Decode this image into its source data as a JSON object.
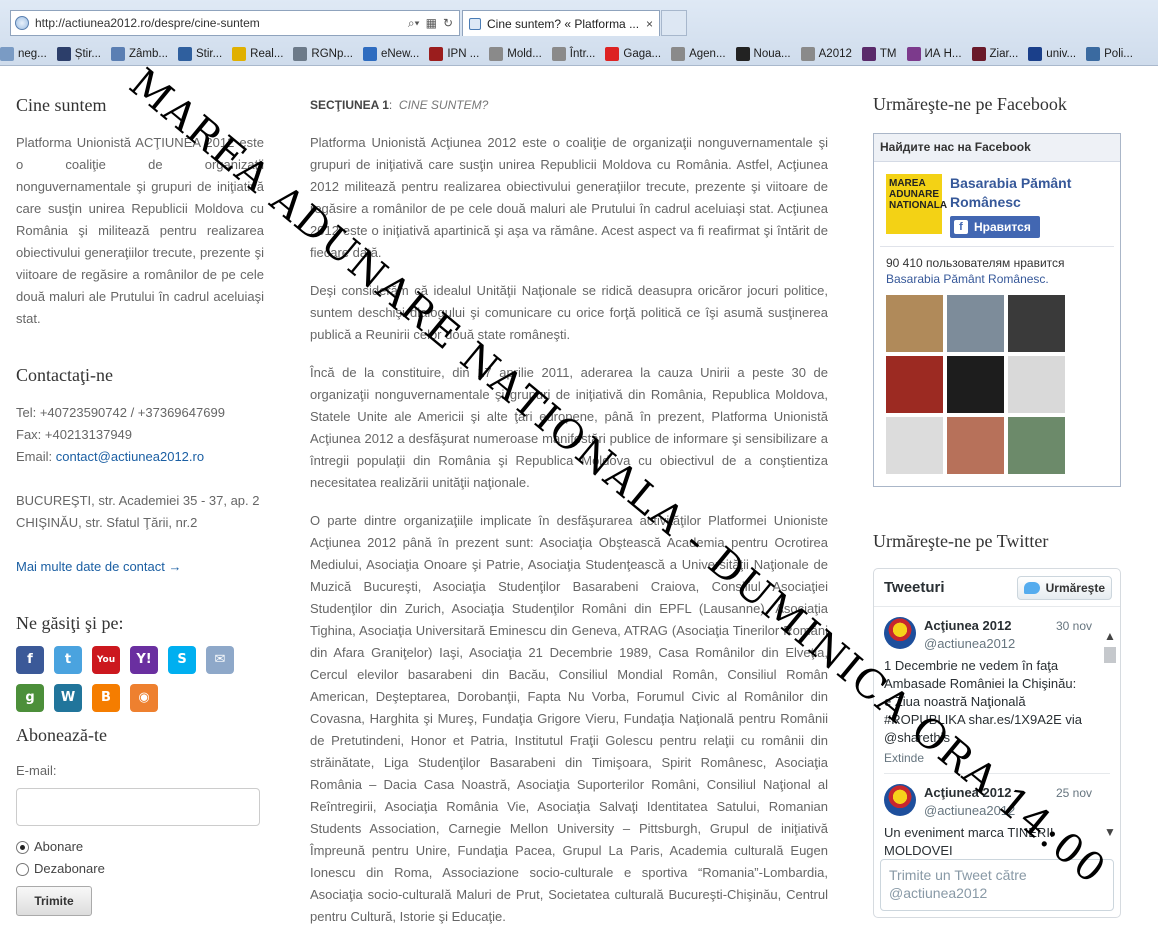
{
  "browser": {
    "url": "http://actiunea2012.ro/despre/cine-suntem",
    "tab_title": "Cine suntem? « Platforma ...",
    "tab_close": "×",
    "favorites": [
      {
        "label": "neg...",
        "color": "#7a9bc4"
      },
      {
        "label": "Știr...",
        "color": "#2c3e6a"
      },
      {
        "label": "Zâmb...",
        "color": "#5b7fb3"
      },
      {
        "label": "Stir...",
        "color": "#2f5f9e"
      },
      {
        "label": "Real...",
        "color": "#e0b000"
      },
      {
        "label": "RGNp...",
        "color": "#6c7a89"
      },
      {
        "label": "eNew...",
        "color": "#2e6cc0"
      },
      {
        "label": "IPN ...",
        "color": "#9b1d1d"
      },
      {
        "label": "Mold...",
        "color": "#8a8a8a"
      },
      {
        "label": "Într...",
        "color": "#8a8a8a"
      },
      {
        "label": "Gaga...",
        "color": "#d22"
      },
      {
        "label": "Agen...",
        "color": "#8a8a8a"
      },
      {
        "label": "Noua...",
        "color": "#222"
      },
      {
        "label": "A2012",
        "color": "#8a8a8a"
      },
      {
        "label": "TM",
        "color": "#5a2a6a"
      },
      {
        "label": "ИА Н...",
        "color": "#7c3a8c"
      },
      {
        "label": "Ziar...",
        "color": "#6a1a2a"
      },
      {
        "label": "univ...",
        "color": "#1a3f8a"
      },
      {
        "label": "Poli...",
        "color": "#3a6aa0"
      }
    ]
  },
  "left": {
    "about_title": "Cine suntem",
    "about_text": "Platforma Unionistă ACŢIUNEA 2012 este o coaliţie de organizaţii nonguvernamentale şi grupuri de iniţiativă care susţin unirea Republicii Moldova cu România şi militează pentru realizarea obiectivului generaţiilor trecute, prezente şi viitoare de regăsire a românilor de pe cele două maluri ale Prutului în cadrul aceluiaşi stat.",
    "contact_title": "Contactaţi-ne",
    "tel": "Tel: +40723590742 / +37369647699",
    "fax": "Fax: +40213137949",
    "email_label": "Email: ",
    "email": "contact@actiunea2012.ro",
    "addr1": "BUCUREŞTI, str. Academiei 35 - 37, ap. 2",
    "addr2": "CHIŞINĂU, str. Sfatul Ţării, nr.2",
    "more_contact": "Mai multe date de contact →",
    "social_title": "Ne găsiţi şi pe:",
    "social_icons": [
      {
        "name": "facebook-icon",
        "glyph": "f",
        "color": "#3b5998"
      },
      {
        "name": "twitter-icon",
        "glyph": "t",
        "color": "#4aa3df"
      },
      {
        "name": "youtube-icon",
        "glyph": "You",
        "color": "#cc181e"
      },
      {
        "name": "yahoo-icon",
        "glyph": "Y!",
        "color": "#6a2fa0"
      },
      {
        "name": "skype-icon",
        "glyph": "S",
        "color": "#00aff0"
      },
      {
        "name": "mail-icon",
        "glyph": "✉",
        "color": "#8ea8c9"
      },
      {
        "name": "google-icon",
        "glyph": "g",
        "color": "#4c8f3a"
      },
      {
        "name": "wordpress-icon",
        "glyph": "W",
        "color": "#21759b"
      },
      {
        "name": "blogger-icon",
        "glyph": "B",
        "color": "#f57d00"
      },
      {
        "name": "rss-icon",
        "glyph": "◉",
        "color": "#ee802f"
      }
    ],
    "subscribe_title": "Abonează-te",
    "email_field_label": "E-mail:",
    "opt_subscribe": "Abonare",
    "opt_unsubscribe": "Dezabonare",
    "submit": "Trimite"
  },
  "main": {
    "section_label": "SECŢIUNEA 1",
    "section_title": "CINE SUNTEM?",
    "paragraphs": [
      "Platforma Unionistă Acţiunea 2012 este o coaliţie de organizaţii nonguvernamentale şi grupuri de iniţiativă care susţin unirea Republicii Moldova cu România. Astfel, Acţiunea 2012 militează pentru realizarea obiectivului generaţiilor trecute, prezente şi viitoare de regăsire a românilor de pe cele două maluri ale Prutului în cadrul aceluiaşi stat. Acţiunea 2012 este o iniţiativă apartinică şi aşa va rămâne. Acest aspect va fi reafirmat şi întărit de fiecare dată.",
      "Deşi considerăm că idealul Unităţii Naţionale se ridică deasupra oricăror jocuri politice, suntem deschişi dialogului şi comunicare cu orice forţă politică ce îşi asumă susţinerea publică a Reunirii celor două state româneşti.",
      "Încă de la constituire, din 17 aprilie 2011, aderarea la cauza Unirii a peste 30 de organizaţii nonguvernamentale şi grupuri de iniţiativă din România, Republica Moldova, Statele Unite ale Americii şi alte ţări europene, până în prezent, Platforma Unionistă Acţiunea 2012 a desfăşurat numeroase manifestări publice de informare şi sensibilizare a întregii populaţii din România şi Republica Moldova cu obiectivul de a conştientiza necesitatea realizării unităţii naţionale.",
      "O parte dintre organizaţiile implicate în desfăşurarea activităţilor Platformei Unioniste Acţiunea 2012 până în prezent sunt: Asociaţia Obştească Academia pentru Ocrotirea Mediului, Asociaţia Onoare şi Patrie, Asociaţia Studenţească a Universităţii Naţionale de Muzică Bucureşti, Asociaţia Studenţilor Basarabeni Craiova, Consiliul Asociaţiei Studenţilor din Zurich, Asociaţia Studenţilor Români din EPFL (Lausanne), Asociaţia Tighina, Asociaţia Universitară Eminescu din Geneva, ATRAG (Asociaţia Tinerilor Români din Afara Graniţelor) Iaşi, Asociaţia 21 Decembrie 1989, Casa Românilor din Elveţia, Cercul elevilor basarabeni din Bacău, Consiliul Mondial Român, Consiliul Român American, Deşteptarea, Dorobanţii, Fapta Nu Vorba, Forumul Civic al Românilor din Covasna, Harghita şi Mureş, Fundaţia Grigore Vieru, Fundaţia Naţională pentru Românii de Pretutindeni, Honor et Patria, Institutul Fraţii Golescu pentru relaţii cu românii din străinătate, Liga Studenţilor Basarabeni din Timişoara, Spirit Românesc, Asociaţia România – Dacia Casa Noastră, Asociaţia Suporterilor Români, Consiliul Naţional al Reîntregirii, Asociaţia România Vie, Asociaţia Salvaţi Identitatea Satului, Romanian Students Association, Carnegie Mellon University – Pittsburgh, Grupul de iniţiativă Împreună pentru Unire, Fundaţia Pacea, Grupul La Paris, Academia culturală Eugen Ionescu din Roma, Associazione socio-culturale e sportiva “Romania”-Lombardia, Asociaţia socio-culturală Maluri de Prut, Societatea culturală Bucureşti-Chişinău, Centrul pentru Cultură, Istorie şi Educaţie."
    ]
  },
  "right": {
    "fb_title": "Urmăreşte-ne pe Facebook",
    "fb_header": "Найдите нас на Facebook",
    "fb_logo_text": "MAREA ADUNARE NATIONALA",
    "fb_page_name": "Basarabia Pământ Românesc",
    "fb_like": "Нравится",
    "fb_count_text": "90 410 пользователям нравится",
    "fb_count_page": "Basarabia Pământ Românesc.",
    "fb_faces": [
      "#b08a5a",
      "#7d8c9a",
      "#3a3a3a",
      "#9c2a22",
      "#1d1d1d",
      "#d9d9d9",
      "#dcdcdc",
      "#b7715a",
      "#6c8a6a"
    ],
    "tw_title": "Urmăreşte-ne pe Twitter",
    "tw_header": "Tweeturi",
    "tw_follow": "Urmăreşte",
    "tweets": [
      {
        "name": "Acţiunea 2012",
        "handle": "@actiunea2012",
        "date": "30 nov",
        "text": "1 Decembrie ne vedem în faţa Ambasade României la Chişinău: e Ziua noastră Naţională #ROPUBLIKA shar.es/1X9A2E via @sharethis",
        "expand": "Extinde"
      },
      {
        "name": "Acţiunea 2012",
        "handle": "@actiunea2012",
        "date": "25 nov",
        "text": "Un eveniment marca TINERII MOLDOVEI",
        "expand": ""
      }
    ],
    "tw_compose": "Trimite un Tweet către @actiunea2012"
  },
  "overlay": {
    "line": "MAREA ADUNARE NATIONALA - DUMINICA ORA 14:00"
  }
}
